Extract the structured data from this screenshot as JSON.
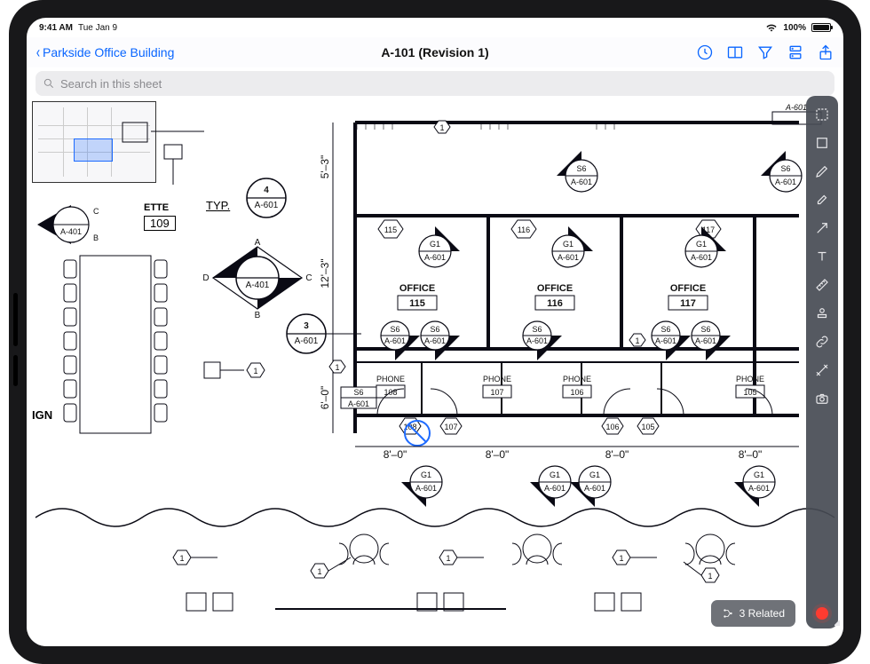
{
  "statusbar": {
    "time": "9:41 AM",
    "date": "Tue Jan 9",
    "battery": "100%"
  },
  "nav": {
    "back": "Parkside Office Building",
    "title": "A-101 (Revision 1)"
  },
  "search": {
    "placeholder": "Search in this sheet"
  },
  "related": {
    "label": "3 Related"
  },
  "labels": {
    "ign": "IGN",
    "ette": "ETTE",
    "t09": "109",
    "typ": "TYP.",
    "office": "OFFICE",
    "phone": "PHONE"
  },
  "dims": {
    "h1": "5'–3\"",
    "h2": "12'–3\"",
    "h3": "6'–0\"",
    "w": "8'–0\""
  },
  "rooms": {
    "office": [
      {
        "num": "115"
      },
      {
        "num": "116"
      },
      {
        "num": "117"
      }
    ],
    "phone": [
      {
        "num": "108"
      },
      {
        "num": "107"
      },
      {
        "num": "106"
      },
      {
        "num": "105"
      }
    ]
  },
  "doortags": [
    "115",
    "116",
    "117",
    "108",
    "107",
    "106",
    "105"
  ],
  "detail": {
    "three": {
      "top": "3",
      "bot": "A-601"
    },
    "four": {
      "top": "4",
      "bot": "A-601"
    }
  },
  "section": {
    "g1": {
      "top": "G1",
      "bot": "A-601"
    },
    "s6": {
      "top": "S6",
      "bot": "A-601"
    },
    "a401": {
      "top": "",
      "bot": "A-401"
    }
  },
  "hexes": [
    "1",
    "1",
    "1",
    "1",
    "1",
    "1",
    "1",
    "1",
    "1"
  ],
  "northdiamond": {
    "labels": [
      "A",
      "B",
      "C",
      "D"
    ],
    "center": "A-401"
  },
  "cornerA601": "A-601"
}
